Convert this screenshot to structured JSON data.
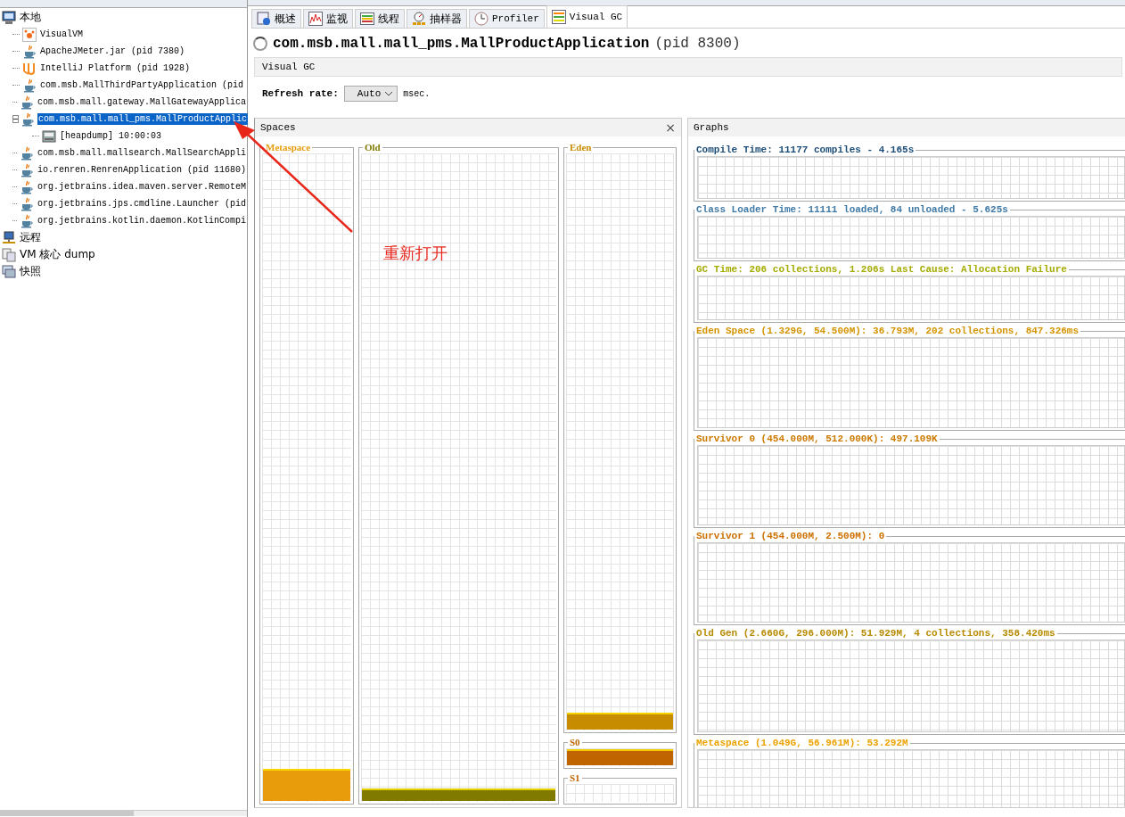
{
  "tree": [
    {
      "label": "本地",
      "kind": "computer",
      "selected": false,
      "children": [
        {
          "label": "VisualVM",
          "kind": "visualvm",
          "selected": false
        },
        {
          "label": "ApacheJMeter.jar (pid 7380)",
          "kind": "java",
          "selected": false
        },
        {
          "label": "IntelliJ Platform (pid 1928)",
          "kind": "intellij",
          "selected": false
        },
        {
          "label": "com.msb.MallThirdPartyApplication (pid",
          "kind": "java",
          "selected": false
        },
        {
          "label": "com.msb.mall.gateway.MallGatewayApplica",
          "kind": "java",
          "selected": false
        },
        {
          "label": "com.msb.mall.mall_pms.MallProductApplic",
          "kind": "java",
          "selected": true,
          "expanded": true,
          "children": [
            {
              "label": "[heapdump] 10:00:03",
              "kind": "heapdump",
              "selected": false
            }
          ]
        },
        {
          "label": "com.msb.mall.mallsearch.MallSearchAppli",
          "kind": "java",
          "selected": false
        },
        {
          "label": "io.renren.RenrenApplication (pid 11680)",
          "kind": "java",
          "selected": false
        },
        {
          "label": "org.jetbrains.idea.maven.server.RemoteM",
          "kind": "java",
          "selected": false
        },
        {
          "label": "org.jetbrains.jps.cmdline.Launcher (pid",
          "kind": "java",
          "selected": false
        },
        {
          "label": "org.jetbrains.kotlin.daemon.KotlinCompi",
          "kind": "java",
          "selected": false
        }
      ]
    },
    {
      "label": "远程",
      "kind": "remote",
      "selected": false
    },
    {
      "label": "VM 核心 dump",
      "kind": "coredump",
      "selected": false
    },
    {
      "label": "快照",
      "kind": "snapshot",
      "selected": false
    }
  ],
  "tabs": [
    {
      "label": "概述",
      "kind": "overview",
      "selected": false
    },
    {
      "label": "监视",
      "kind": "monitor",
      "selected": false
    },
    {
      "label": "线程",
      "kind": "threads",
      "selected": false
    },
    {
      "label": "抽样器",
      "kind": "sampler",
      "selected": false
    },
    {
      "label": "Profiler",
      "kind": "profiler",
      "selected": false
    },
    {
      "label": "Visual GC",
      "kind": "visualgc",
      "selected": true
    }
  ],
  "app_title": {
    "name": "com.msb.mall.mall_pms.MallProductApplication",
    "pid": "(pid 8300)"
  },
  "section_title": "Visual GC",
  "refresh": {
    "label": "Refresh rate:",
    "value": "Auto",
    "unit": "msec."
  },
  "spaces": {
    "title": "Spaces",
    "close": "×",
    "items": [
      {
        "name": "Metaspace",
        "color": "#e89c0c",
        "level": 0.05
      },
      {
        "name": "Old",
        "color": "#807a00",
        "level": 0.02
      },
      {
        "name": "Eden",
        "color": "#c88c00",
        "level": 0.03
      },
      {
        "name": "S0",
        "color": "#c06400",
        "level": 1
      },
      {
        "name": "S1",
        "color": "#c06400",
        "level": 0
      }
    ]
  },
  "graphs": {
    "title": "Graphs",
    "items": [
      {
        "title": "Compile Time: 11177 compiles - 4.165s",
        "color": "#1c4d78"
      },
      {
        "title": "Class Loader Time: 11111 loaded, 84 unloaded - 5.625s",
        "color": "#3f7aa8"
      },
      {
        "title": "GC Time: 206 collections, 1.206s  Last Cause: Allocation Failure",
        "color": "#a4ac00"
      },
      {
        "title": "Eden Space (1.329G, 54.500M): 36.793M, 202 collections, 847.326ms",
        "color": "#d49400"
      },
      {
        "title": "Survivor 0 (454.000M, 512.000K): 497.109K",
        "color": "#cc7a00"
      },
      {
        "title": "Survivor 1 (454.000M, 2.500M): 0",
        "color": "#cc7000"
      },
      {
        "title": "Old Gen (2.660G, 296.000M): 51.929M, 4 collections, 358.420ms",
        "color": "#b88a00"
      },
      {
        "title": "Metaspace (1.049G, 56.961M): 53.292M",
        "color": "#eca200"
      }
    ]
  },
  "annotation": {
    "text": "重新打开"
  }
}
